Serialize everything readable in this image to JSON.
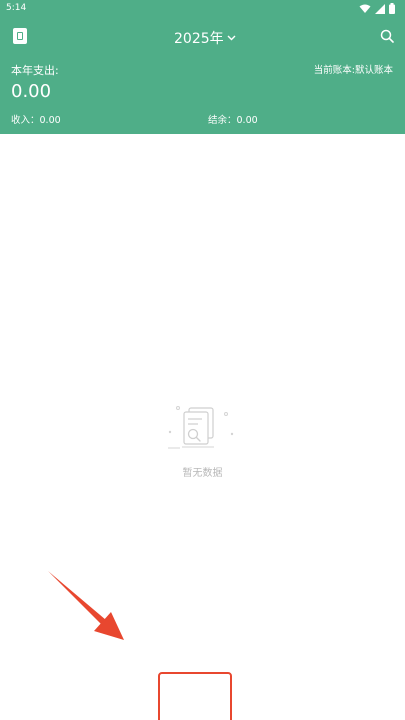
{
  "status_bar": {
    "time": "5:14"
  },
  "header": {
    "year_label": "2025年",
    "expense_label": "本年支出:",
    "expense_value": "0.00",
    "current_book": "当前账本:默认账本",
    "income_label": "收入：0.00",
    "balance_label": "结余：0.00"
  },
  "empty_state": {
    "text": "暂无数据"
  },
  "colors": {
    "primary": "#4fae88",
    "annotation": "#e8472f",
    "muted": "#b8b8b8"
  },
  "icons": [
    "wifi-icon",
    "signal-icon",
    "battery-icon",
    "ledger-icon",
    "chevron-down-icon",
    "search-icon",
    "empty-document-icon",
    "arrow-annotation"
  ]
}
